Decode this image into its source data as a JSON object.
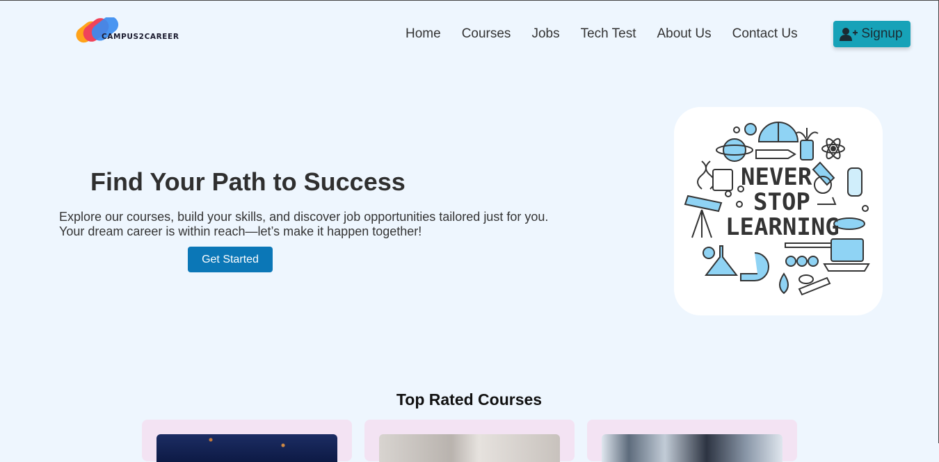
{
  "brand": {
    "name": "CAMPUS2CAREER"
  },
  "nav": {
    "items": [
      "Home",
      "Courses",
      "Jobs",
      "Tech Test",
      "About Us",
      "Contact Us"
    ],
    "signup_label": "Signup"
  },
  "hero": {
    "title": "Find Your Path to Success",
    "description_line1": "Explore our courses, build your skills, and discover job opportunities tailored just for you.",
    "description_line2": "Your dream career is within reach—let’s make it happen together!",
    "cta_label": "Get Started",
    "image_text": [
      "NEVER",
      "STOP",
      "LEARNING"
    ]
  },
  "top_rated": {
    "title": "Top Rated Courses"
  },
  "colors": {
    "page_bg": "#eef6fe",
    "signup_bg": "#17a2b8",
    "cta_bg": "#0b77b7",
    "card_bg": "#f3e3f3"
  }
}
